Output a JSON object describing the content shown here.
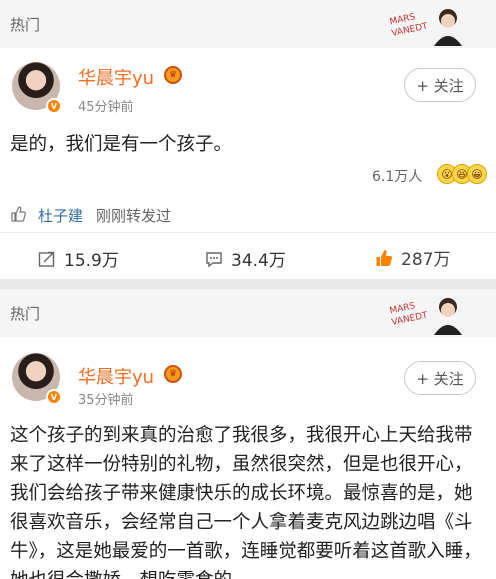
{
  "posts": [
    {
      "section_label": "热门",
      "sticker_text": "MARS VANEDT",
      "username": "华晨宇yu",
      "time": "45分钟前",
      "follow_label": "+ 关注",
      "text": "是的，我们是有一个孩子。",
      "reaction_count": "6.1万人",
      "reposter": "杜子建",
      "repost_note": "刚刚转发过",
      "reposts": "15.9万",
      "comments": "34.4万",
      "likes": "287万"
    },
    {
      "section_label": "热门",
      "sticker_text": "MARS VANEDT",
      "username": "华晨宇yu",
      "time": "35分钟前",
      "follow_label": "+ 关注",
      "text": "这个孩子的到来真的治愈了我很多，我很开心上天给我带来了这样一份特别的礼物，虽然很突然，但是也很开心，我们会给孩子带来健康快乐的成长环境。最惊喜的是，她很喜欢音乐，会经常自己一个人拿着麦克风边跳边唱《斗牛》，这是她最爱的一首歌，连睡觉都要听着这首歌入睡，她也很会撒娇，想吃零食的"
    }
  ],
  "colors": {
    "accent": "#f26d21",
    "like": "#ff8200",
    "link": "#3a6ea5"
  },
  "icons": [
    "thumb-icon",
    "share-icon",
    "comment-icon",
    "like-icon",
    "crown-icon",
    "verified-icon"
  ]
}
